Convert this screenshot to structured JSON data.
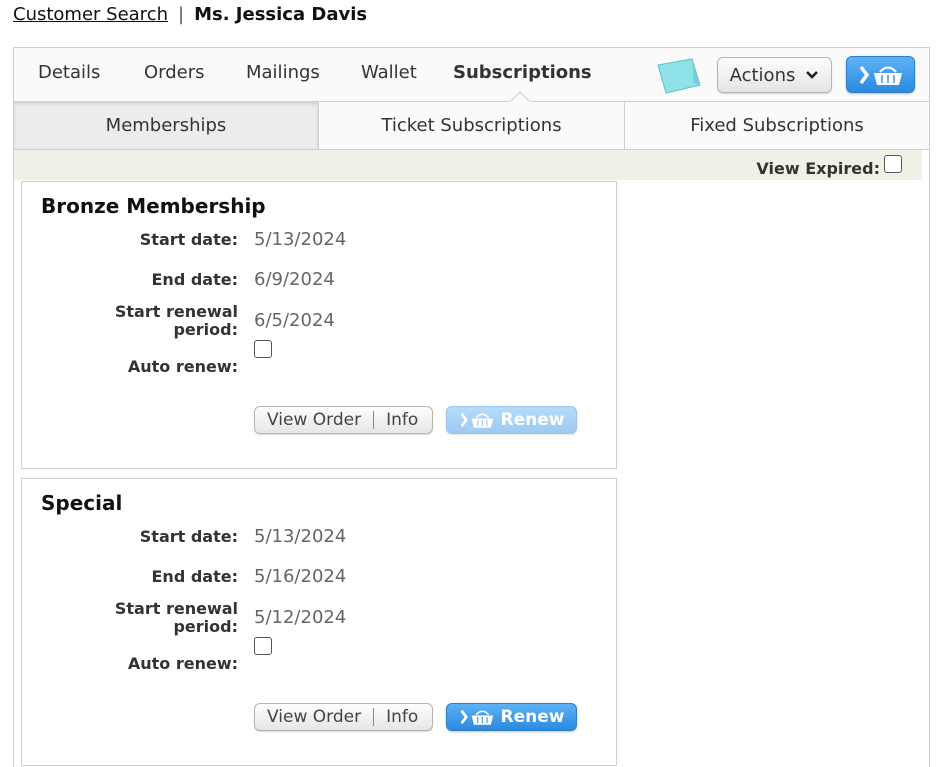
{
  "breadcrumb": {
    "link": "Customer Search",
    "separator": "|",
    "customer_name": "Ms. Jessica Davis"
  },
  "tabs": [
    {
      "label": "Details",
      "active": false
    },
    {
      "label": "Orders",
      "active": false
    },
    {
      "label": "Mailings",
      "active": false
    },
    {
      "label": "Wallet",
      "active": false
    },
    {
      "label": "Subscriptions",
      "active": true
    }
  ],
  "toolbar": {
    "note_icon": "sticky-note-icon",
    "actions_label": "Actions",
    "actions_icon": "chevron-down-icon",
    "cart_icon": "basket-icon"
  },
  "subtabs": [
    {
      "label": "Memberships",
      "active": true
    },
    {
      "label": "Ticket Subscriptions",
      "active": false
    },
    {
      "label": "Fixed Subscriptions",
      "active": false
    }
  ],
  "filter": {
    "label": "View Expired:",
    "checked": false
  },
  "labels": {
    "start_date": "Start date:",
    "end_date": "End date:",
    "renewal_line1": "Start renewal",
    "renewal_line2": "period:",
    "auto_renew": "Auto renew:",
    "view_order": "View Order",
    "info": "Info",
    "renew": "Renew"
  },
  "memberships": [
    {
      "title": "Bronze Membership",
      "start_date": "5/13/2024",
      "end_date": "6/9/2024",
      "renewal_start": "6/5/2024",
      "auto_renew": false,
      "renew_enabled": false
    },
    {
      "title": "Special",
      "start_date": "5/13/2024",
      "end_date": "5/16/2024",
      "renewal_start": "5/12/2024",
      "auto_renew": false,
      "renew_enabled": true
    }
  ],
  "colors": {
    "accent_blue": "#2b8ae0",
    "filter_bg": "#eef2e6",
    "note_teal": "#8fe3e8"
  }
}
